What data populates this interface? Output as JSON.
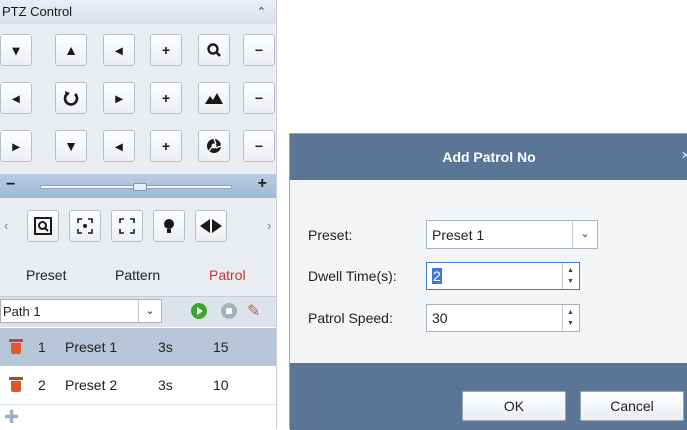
{
  "ptz": {
    "title": "PTZ Control",
    "collapse_icon": "chevron-up-icon",
    "direction_buttons": [
      {
        "name": "up-left",
        "glyph": "▾"
      },
      {
        "name": "up",
        "glyph": "▲"
      },
      {
        "name": "up-right",
        "glyph": "◂"
      },
      {
        "name": "left",
        "glyph": "◂"
      },
      {
        "name": "auto",
        "glyph": "↻"
      },
      {
        "name": "right",
        "glyph": "▸"
      },
      {
        "name": "down-left",
        "glyph": "▸"
      },
      {
        "name": "down",
        "glyph": "▼"
      },
      {
        "name": "down-right",
        "glyph": "◂"
      }
    ],
    "plus_glyph": "+",
    "minus_glyph": "−",
    "slider_minus": "−",
    "slider_plus": "+",
    "slider_level": 0.52,
    "tabs": [
      "Preset",
      "Pattern",
      "Patrol"
    ],
    "active_tab": "Patrol",
    "path_select": {
      "value": "Path 1"
    },
    "patrol_rows": [
      {
        "index": "1",
        "preset": "Preset 1",
        "dwell": "3s",
        "speed": "15",
        "selected": true
      },
      {
        "index": "2",
        "preset": "Preset 2",
        "dwell": "3s",
        "speed": "10",
        "selected": false
      }
    ],
    "colors": {
      "selected_row": "#b7c6d9",
      "active_tab": "#d0312d"
    }
  },
  "dialog": {
    "title": "Add Patrol No",
    "close_glyph": "×",
    "preset_label": "Preset:",
    "preset_value": "Preset 1",
    "dwell_label": "Dwell Time(s):",
    "dwell_value": "2",
    "speed_label": "Patrol Speed:",
    "speed_value": "30",
    "ok_label": "OK",
    "cancel_label": "Cancel",
    "colors": {
      "header": "#5a7596",
      "footer": "#5a7596"
    }
  }
}
